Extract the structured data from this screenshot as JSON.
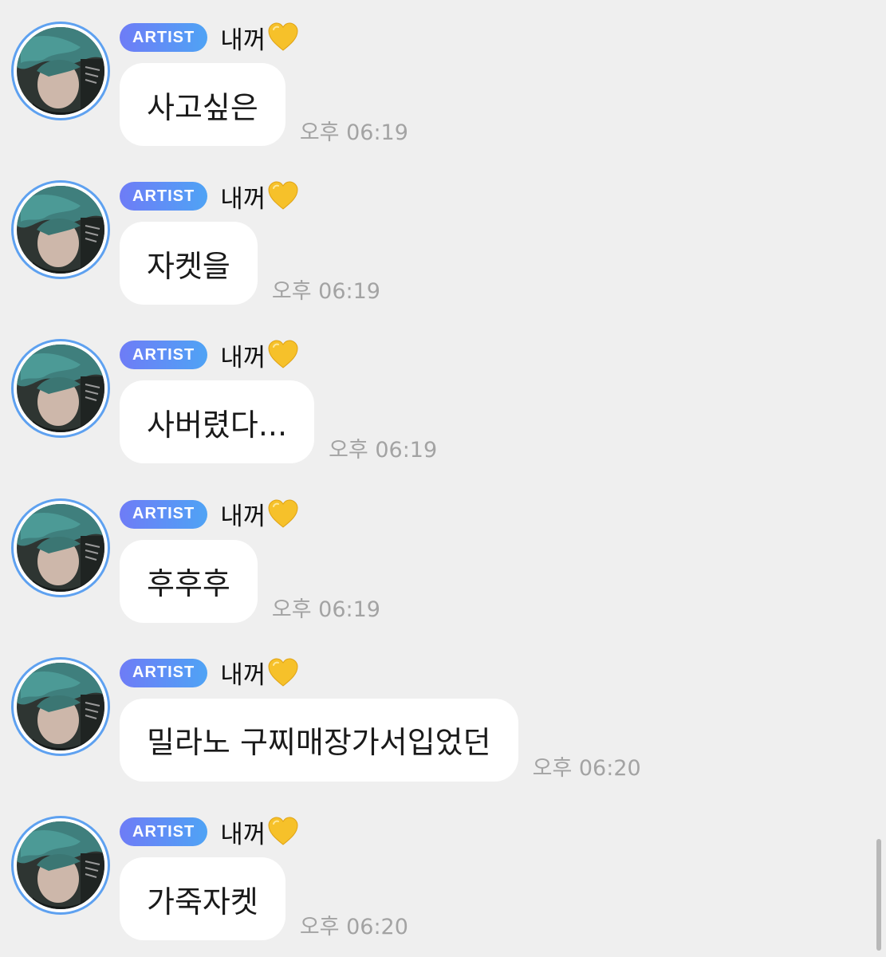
{
  "messages": [
    {
      "badge": "ARTIST",
      "sender": "내꺼",
      "text": "사고싶은",
      "time": "오후 06:19"
    },
    {
      "badge": "ARTIST",
      "sender": "내꺼",
      "text": "자켓을",
      "time": "오후 06:19"
    },
    {
      "badge": "ARTIST",
      "sender": "내꺼",
      "text": "사버렸다...",
      "time": "오후 06:19"
    },
    {
      "badge": "ARTIST",
      "sender": "내꺼",
      "text": "후후후",
      "time": "오후 06:19"
    },
    {
      "badge": "ARTIST",
      "sender": "내꺼",
      "text": "밀라노 구찌매장가서입었던",
      "time": "오후 06:20"
    },
    {
      "badge": "ARTIST",
      "sender": "내꺼",
      "text": "가죽자켓",
      "time": "오후 06:20"
    }
  ],
  "colors": {
    "background": "#efefef",
    "badge_start": "#6e7cf6",
    "badge_end": "#4fa3f5",
    "avatar_ring": "#5ea1f0",
    "heart": "#f6c12a",
    "timestamp": "#a3a3a3"
  },
  "icons": {
    "sender_emoji": "yellow-heart-icon"
  }
}
